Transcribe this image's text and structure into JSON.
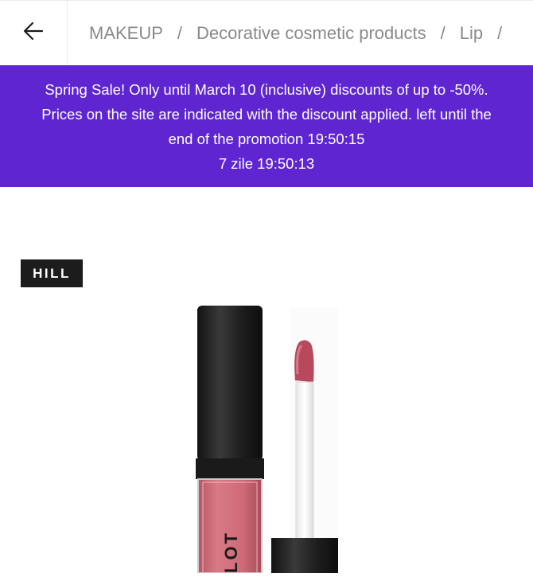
{
  "header": {
    "back_icon": "arrow-left-icon",
    "breadcrumb": [
      "MAKEUP",
      "Decorative cosmetic products",
      "Lip"
    ],
    "separator": "/"
  },
  "promo": {
    "line1": "Spring Sale! Only until March 10 (inclusive) discounts of up to -50%.",
    "line2": "Prices on the site are indicated with the discount applied. left until the",
    "line3": "end of the promotion 19:50:15",
    "line4": "7 zile 19:50:13",
    "background": "#5e25d0"
  },
  "product": {
    "badge": "HILL",
    "tube_label": "LOT",
    "tube_color": "#d26a78",
    "cap_color": "#1e1e1e"
  }
}
